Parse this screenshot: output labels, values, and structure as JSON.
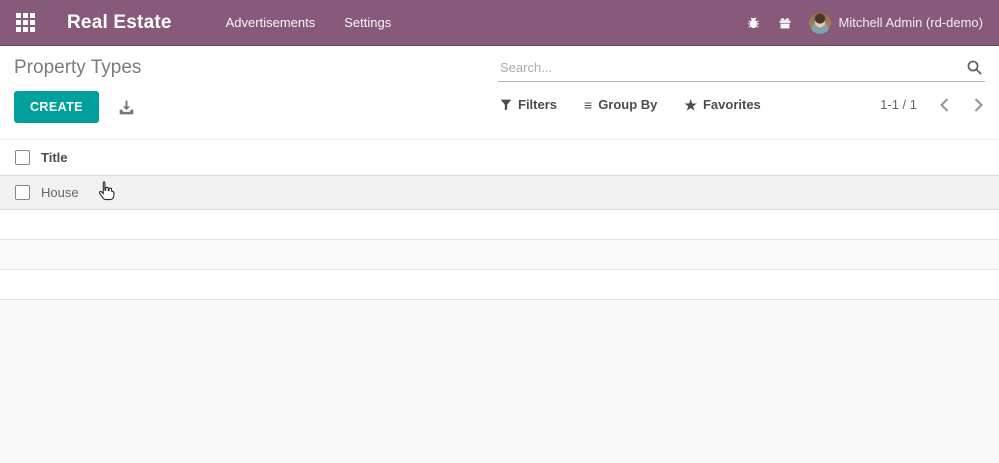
{
  "navbar": {
    "app_title": "Real Estate",
    "menu_items": [
      {
        "label": "Advertisements"
      },
      {
        "label": "Settings"
      }
    ],
    "user_name": "Mitchell Admin (rd-demo)",
    "color": "#875A7B",
    "icons": {
      "apps": "grid-3x3",
      "debug": "bug",
      "support": "gift"
    }
  },
  "page": {
    "title": "Property Types"
  },
  "search": {
    "placeholder": "Search..."
  },
  "toolbar": {
    "create_label": "CREATE",
    "export_icon": "download-arrow",
    "filters_label": "Filters",
    "group_by_label": "Group By",
    "favorites_label": "Favorites",
    "accent_color": "#00A09D"
  },
  "glyphs": {
    "bars": "≡",
    "star": "★"
  },
  "pagination": {
    "range": "1-1 / 1",
    "prev_icon": "chevron-left",
    "next_icon": "chevron-right"
  },
  "table": {
    "columns": [
      {
        "label": "Title"
      }
    ],
    "rows": [
      {
        "title": "House",
        "selected": false
      }
    ]
  },
  "cursor": {
    "type": "hand-pointer"
  }
}
